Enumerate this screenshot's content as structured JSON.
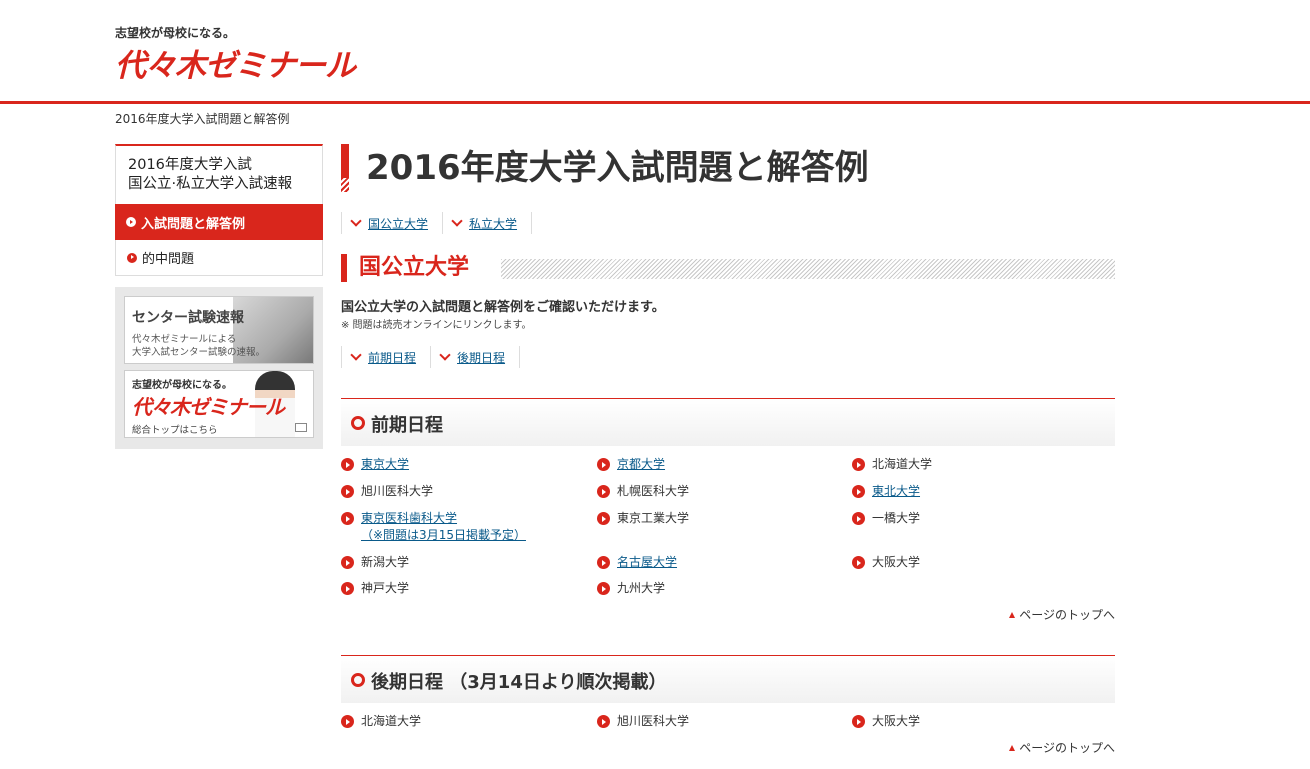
{
  "header": {
    "tagline": "志望校が母校になる。",
    "logo": "代々木ゼミナール"
  },
  "breadcrumb": "2016年度大学入試問題と解答例",
  "sidebar": {
    "title_line1": "2016年度大学入試",
    "title_line2": "国公立·私立大学入試速報",
    "items": [
      {
        "label": "入試問題と解答例",
        "active": true
      },
      {
        "label": "的中問題",
        "active": false
      }
    ],
    "banners": {
      "center": {
        "title": "センター試験速報",
        "sub1": "代々木ゼミナールによる",
        "sub2": "大学入試センター試験の速報。"
      },
      "top": {
        "tagline": "志望校が母校になる。",
        "logo": "代々木ゼミナール",
        "sub": "総合トップはこちら"
      }
    }
  },
  "main": {
    "title": "2016年度大学入試問題と解答例",
    "anchors": [
      "国公立大学",
      "私立大学"
    ],
    "section": {
      "title": "国公立大学",
      "intro": "国公立大学の入試問題と解答例をご確認いただけます。",
      "note": "※ 問題は読売オンラインにリンクします。",
      "anchors": [
        "前期日程",
        "後期日程"
      ]
    },
    "zenki": {
      "title": "前期日程",
      "universities": [
        {
          "name": "東京大学",
          "link": true
        },
        {
          "name": "京都大学",
          "link": true
        },
        {
          "name": "北海道大学",
          "link": false
        },
        {
          "name": "旭川医科大学",
          "link": false
        },
        {
          "name": "札幌医科大学",
          "link": false
        },
        {
          "name": "東北大学",
          "link": true
        },
        {
          "name": "東京医科歯科大学",
          "sub": "（※問題は3月15日掲載予定）",
          "link": true
        },
        {
          "name": "東京工業大学",
          "link": false
        },
        {
          "name": "一橋大学",
          "link": false
        },
        {
          "name": "新潟大学",
          "link": false
        },
        {
          "name": "名古屋大学",
          "link": true
        },
        {
          "name": "大阪大学",
          "link": false
        },
        {
          "name": "神戸大学",
          "link": false
        },
        {
          "name": "九州大学",
          "link": false
        }
      ]
    },
    "kouki": {
      "title": "後期日程 （3月14日より順次掲載）",
      "universities": [
        {
          "name": "北海道大学",
          "link": false
        },
        {
          "name": "旭川医科大学",
          "link": false
        },
        {
          "name": "大阪大学",
          "link": false
        }
      ]
    },
    "pagetop": "ページのトップへ"
  },
  "colors": {
    "accent": "#d9261c",
    "link": "#0a5a8a"
  }
}
